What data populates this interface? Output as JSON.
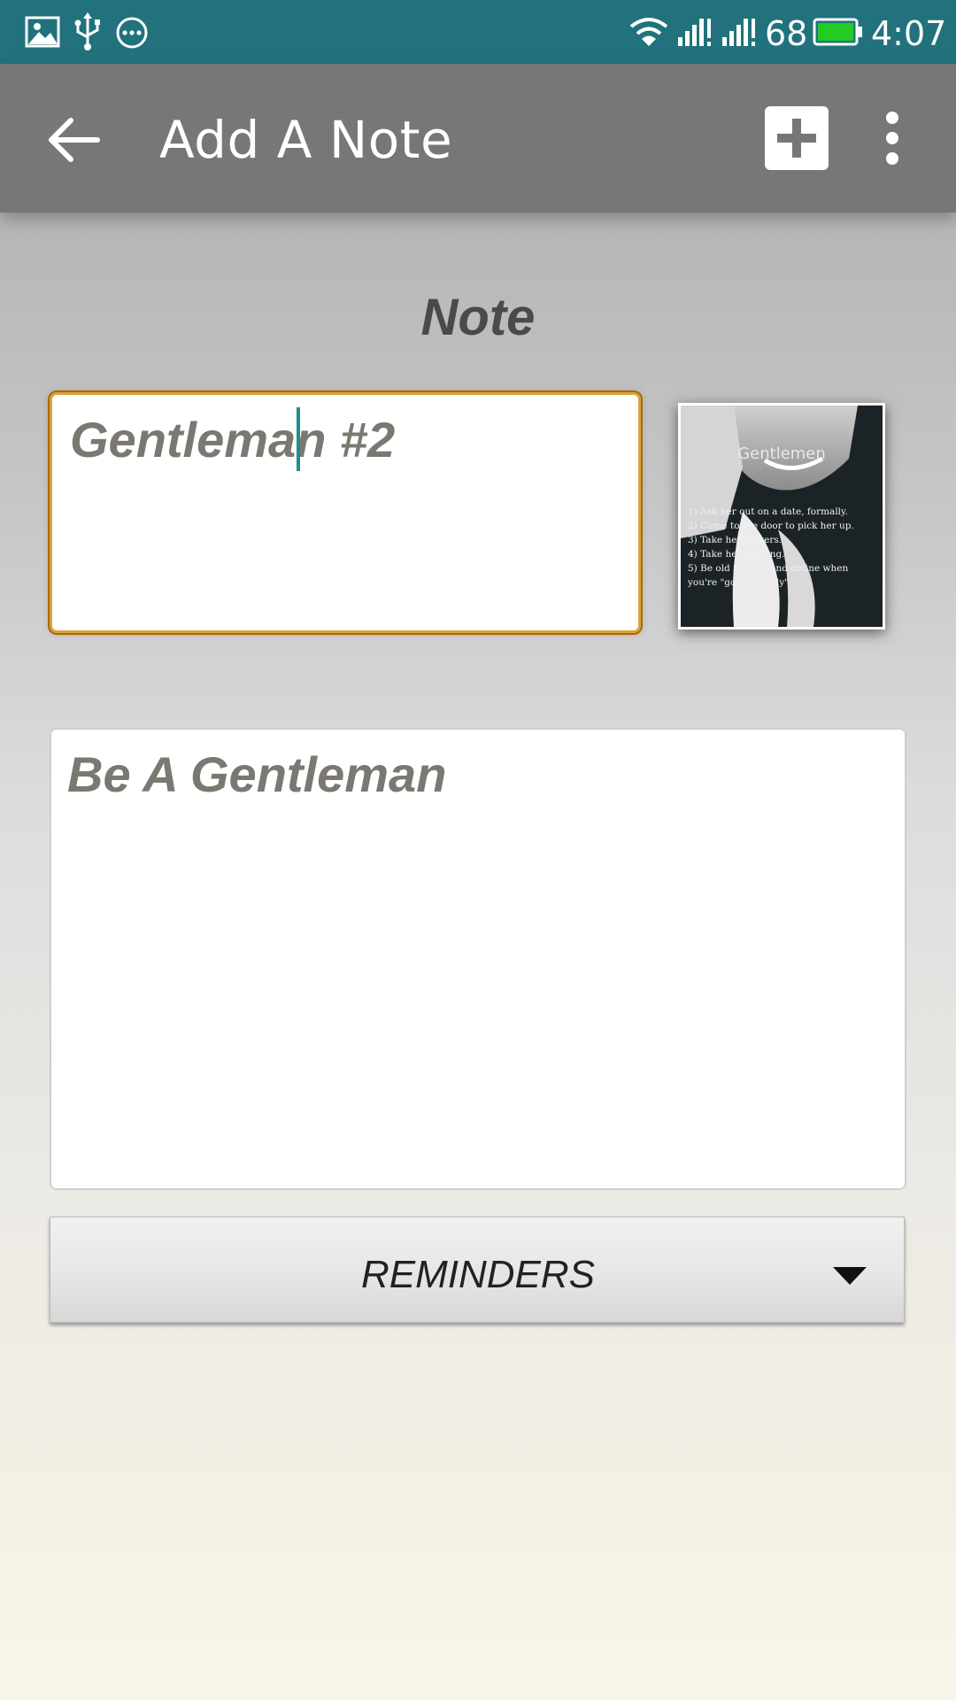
{
  "status_bar": {
    "battery_level": "68",
    "time": "4:07",
    "icons": [
      "image-icon",
      "usb-icon",
      "more-horiz-icon",
      "wifi-icon",
      "signal-1-icon",
      "signal-2-icon",
      "battery-icon"
    ],
    "battery_color": "#22cc22"
  },
  "appbar": {
    "title": "Add A Note",
    "back_icon": "arrow-left-icon",
    "add_icon": "plus-icon",
    "more_icon": "more-vert-icon",
    "background": "#777777"
  },
  "form": {
    "heading": "Note",
    "title_value": "Gentleman #2",
    "body_value": "Be A Gentleman",
    "reminders_label": "REMINDERS",
    "focus_color": "#d9a23a"
  },
  "attachment": {
    "title": "Gentlemen",
    "lines": [
      "1) Ask her out on a date, formally.",
      "2) Come to the door to pick her up.",
      "3) Take her flowers.",
      "4) Take her dancing.",
      "5) Be old fashion and define when",
      "you're \"going steady\""
    ]
  }
}
